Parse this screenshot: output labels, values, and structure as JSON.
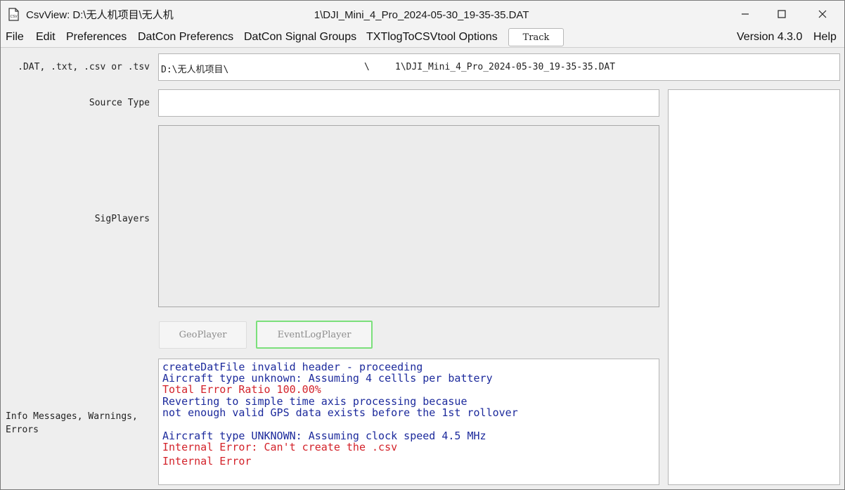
{
  "window": {
    "title_prefix": "CsvView: D:\\无人机项目\\无人机",
    "title_suffix": "1\\DJI_Mini_4_Pro_2024-05-30_19-35-35.DAT"
  },
  "menu": {
    "items": [
      {
        "label": "File"
      },
      {
        "label": "Edit"
      },
      {
        "label": "Preferences"
      },
      {
        "label": "DatCon Preferencs"
      },
      {
        "label": "DatCon Signal Groups"
      },
      {
        "label": "TXTlogToCSVtool Options"
      }
    ],
    "track_button": "Track",
    "version": "Version 4.3.0",
    "help": "Help"
  },
  "file_row": {
    "label": ".DAT, .txt, .csv or .tsv",
    "path_start": "D:\\无人机项目\\",
    "path_mid": "\\",
    "path_end": "1\\DJI_Mini_4_Pro_2024-05-30_19-35-35.DAT"
  },
  "source_type": {
    "label": "Source Type",
    "value": ""
  },
  "sig_players": {
    "label": "SigPlayers"
  },
  "players": {
    "geo": "GeoPlayer",
    "event": "EventLogPlayer"
  },
  "messages": {
    "label_line1": "Info Messages, Warnings,",
    "label_line2": "Errors",
    "lines": [
      {
        "text": "createDatFile invalid header - proceeding",
        "level": "info"
      },
      {
        "text": "Aircraft type unknown: Assuming 4 cellls per battery",
        "level": "info"
      },
      {
        "text": "Total Error Ratio 100.00%",
        "level": "error"
      },
      {
        "text": "Reverting to simple time axis processing becasue",
        "level": "info"
      },
      {
        "text": "not enough valid GPS data exists before the 1st rollover",
        "level": "info"
      },
      {
        "text": "",
        "level": "info"
      },
      {
        "text": "Aircraft type UNKNOWN: Assuming clock speed 4.5 MHz",
        "level": "info"
      },
      {
        "text": "Internal Error: Can't create the .csv",
        "level": "error"
      },
      {
        "text": "Internal Error",
        "level": "error"
      }
    ],
    "colors": {
      "info": "#1c2a9c",
      "error": "#d3222a"
    }
  },
  "icons": {
    "app": "file-icon",
    "minimize": "minimize-icon",
    "maximize": "maximize-icon",
    "close": "close-icon"
  }
}
